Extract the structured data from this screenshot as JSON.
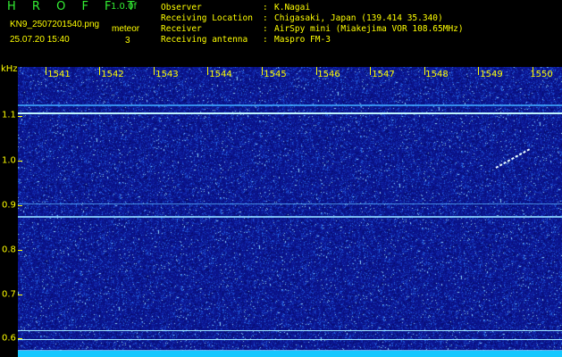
{
  "header": {
    "app_title": "H R O F F T",
    "version": "1.0.0f",
    "filename": "KN9_2507201540.png",
    "datetime": "25.07.20 15:40",
    "meteor_label": "meteor",
    "meteor_count": "3"
  },
  "station_info": [
    {
      "label": "Observer",
      "value": "K.Nagai"
    },
    {
      "label": "Receiving Location",
      "value": "Chigasaki, Japan (139.414 35.340)"
    },
    {
      "label": "Receiver",
      "value": "AirSpy mini (Miakejima VOR 108.65MHz)"
    },
    {
      "label": "Receiving antenna",
      "value": "Maspro FM-3"
    }
  ],
  "colon": ":",
  "spectrogram": {
    "y_unit": "kHz",
    "y_ticks": [
      "1.1",
      "1.0",
      "0.9",
      "0.8",
      "0.7",
      "0.6"
    ],
    "x_ticks": [
      "1541",
      "1542",
      "1543",
      "1544",
      "1545",
      "1546",
      "1547",
      "1548",
      "1549",
      "1550"
    ],
    "colors": {
      "background": "#0b1590",
      "text": "#ffff00",
      "title": "#33ee33",
      "carrier": "#bff6ff",
      "noise_floor": "#16c8ff"
    }
  }
}
